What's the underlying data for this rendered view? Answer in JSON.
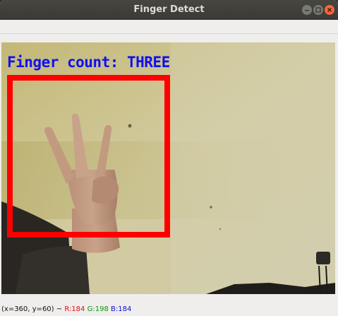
{
  "window": {
    "title": "Finger Detect"
  },
  "overlay": {
    "finger_count_text": "Finger count: THREE",
    "text_color": "#1010f0",
    "box_color": "#ff0000"
  },
  "statusbar": {
    "coords": "(x=360, y=60) ~",
    "r": "R:184",
    "g": "G:198",
    "b": "B:184"
  },
  "colors": {
    "titlebar": "#3b3a35",
    "close_button": "#f1693b",
    "wall": "#c9c28a"
  }
}
